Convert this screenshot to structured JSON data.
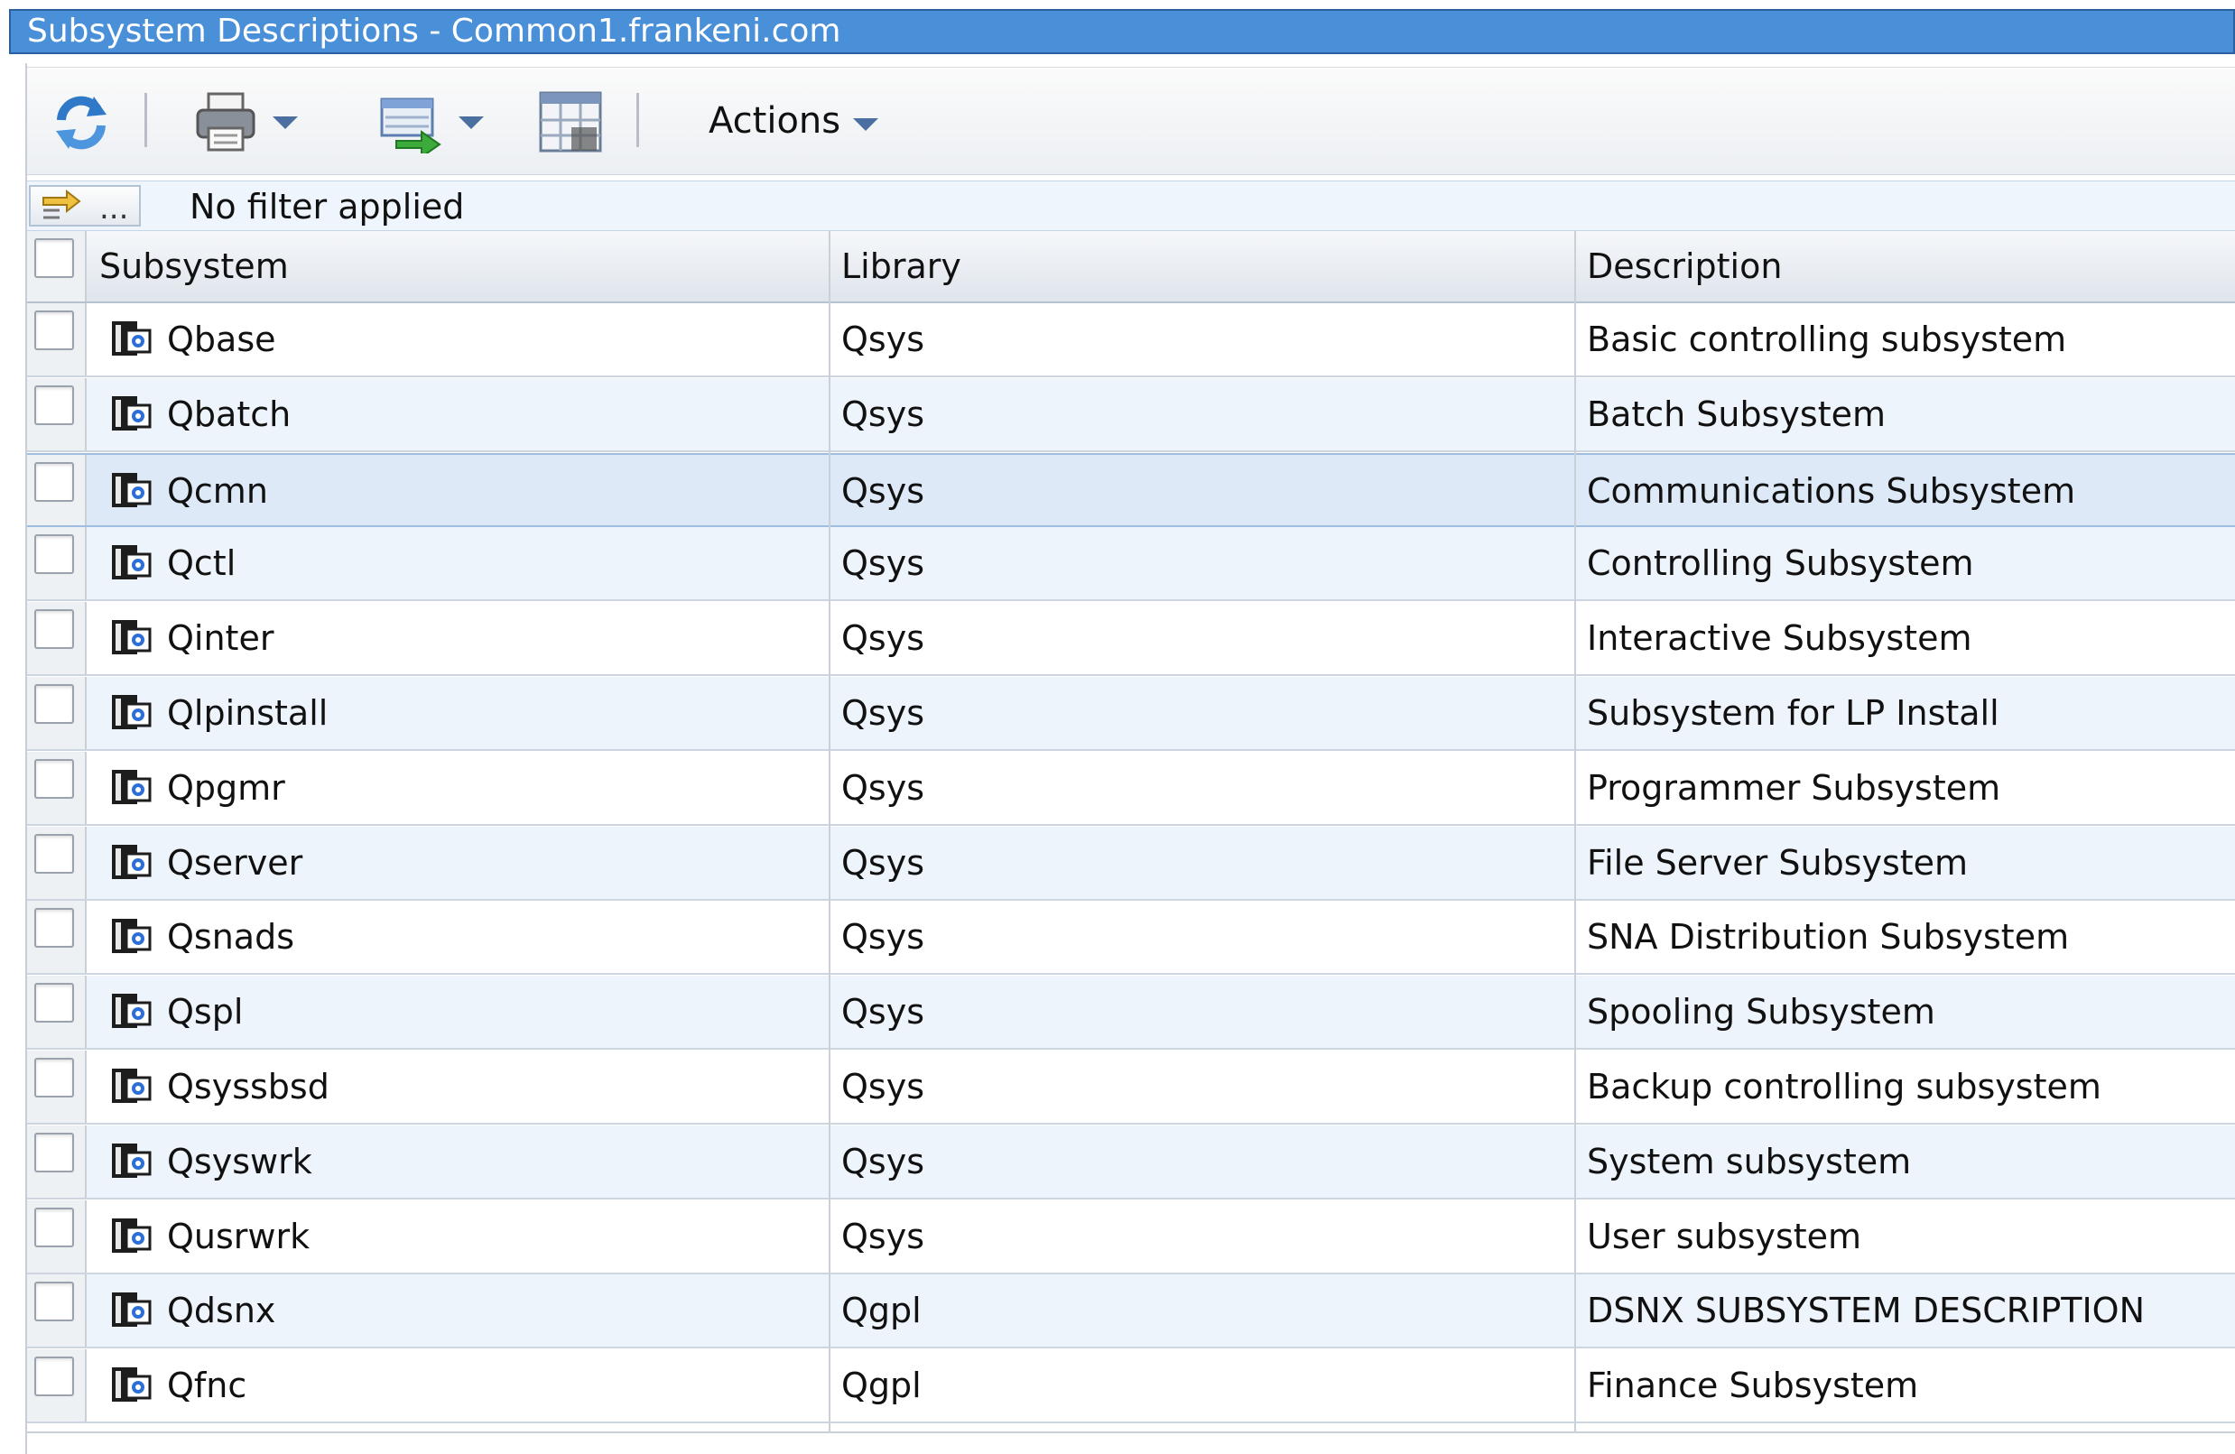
{
  "window": {
    "title": "Subsystem Descriptions - Common1.frankeni.com"
  },
  "toolbar": {
    "refresh_icon": "refresh-icon",
    "print_icon": "print-icon",
    "export_icon": "export-icon",
    "columns_icon": "table-columns-icon",
    "actions_label": "Actions"
  },
  "filter": {
    "status": "No filter applied",
    "dots": "..."
  },
  "columns": {
    "subsystem": "Subsystem",
    "library": "Library",
    "description": "Description"
  },
  "rows": [
    {
      "subsystem": "Qbase",
      "library": "Qsys",
      "description": "Basic controlling subsystem"
    },
    {
      "subsystem": "Qbatch",
      "library": "Qsys",
      "description": "Batch Subsystem"
    },
    {
      "subsystem": "Qcmn",
      "library": "Qsys",
      "description": "Communications Subsystem",
      "selected": true
    },
    {
      "subsystem": "Qctl",
      "library": "Qsys",
      "description": "Controlling Subsystem"
    },
    {
      "subsystem": "Qinter",
      "library": "Qsys",
      "description": "Interactive Subsystem"
    },
    {
      "subsystem": "Qlpinstall",
      "library": "Qsys",
      "description": "Subsystem for LP Install"
    },
    {
      "subsystem": "Qpgmr",
      "library": "Qsys",
      "description": "Programmer Subsystem"
    },
    {
      "subsystem": "Qserver",
      "library": "Qsys",
      "description": "File Server Subsystem"
    },
    {
      "subsystem": "Qsnads",
      "library": "Qsys",
      "description": "SNA Distribution Subsystem"
    },
    {
      "subsystem": "Qspl",
      "library": "Qsys",
      "description": "Spooling Subsystem"
    },
    {
      "subsystem": "Qsyssbsd",
      "library": "Qsys",
      "description": "Backup controlling subsystem"
    },
    {
      "subsystem": "Qsyswrk",
      "library": "Qsys",
      "description": "System subsystem"
    },
    {
      "subsystem": "Qusrwrk",
      "library": "Qsys",
      "description": "User subsystem"
    },
    {
      "subsystem": "Qdsnx",
      "library": "Qgpl",
      "description": "DSNX SUBSYSTEM DESCRIPTION"
    },
    {
      "subsystem": "Qfnc",
      "library": "Qgpl",
      "description": "Finance Subsystem"
    }
  ],
  "colors": {
    "title_bar": "#4a90d9",
    "row_alt": "#eef4fb",
    "row_selected": "#dde9f7"
  }
}
